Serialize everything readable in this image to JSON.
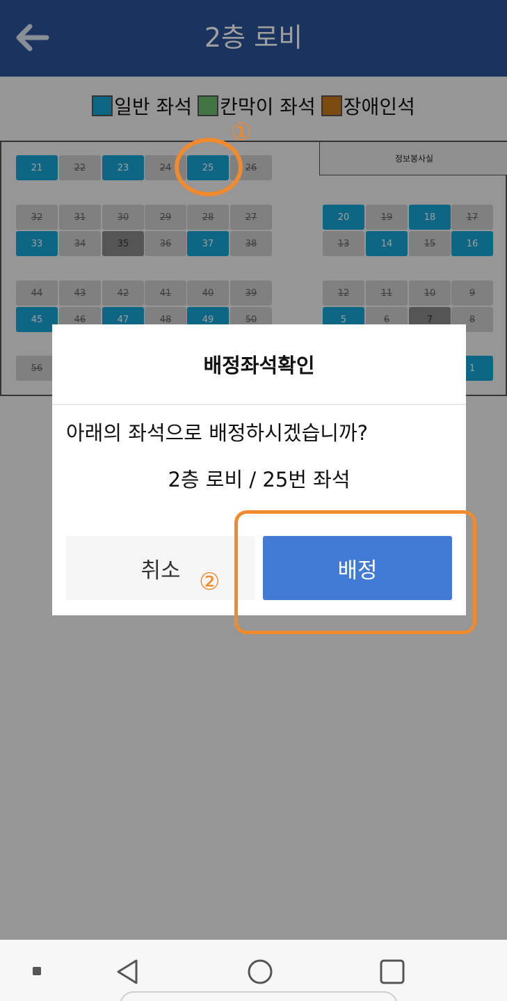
{
  "app_bar": {
    "title": "2층 로비",
    "back_icon": "arrow-left-icon"
  },
  "legend": [
    {
      "label": "일반 좌석",
      "color": "#15a7d6"
    },
    {
      "label": "칸막이 좌석",
      "color": "#6dbb6e"
    },
    {
      "label": "장애인석",
      "color": "#c77a1c"
    }
  ],
  "seat_map": {
    "info_room": "정보봉사실",
    "seats": [
      {
        "label": "21",
        "state": "available"
      },
      {
        "label": "22",
        "state": "taken"
      },
      {
        "label": "23",
        "state": "available"
      },
      {
        "label": "24",
        "state": "taken"
      },
      {
        "label": "25",
        "state": "available"
      },
      {
        "label": "26",
        "state": "taken"
      },
      {
        "label": "32",
        "state": "taken"
      },
      {
        "label": "31",
        "state": "taken"
      },
      {
        "label": "30",
        "state": "taken"
      },
      {
        "label": "29",
        "state": "taken"
      },
      {
        "label": "28",
        "state": "taken"
      },
      {
        "label": "27",
        "state": "taken"
      },
      {
        "label": "33",
        "state": "available"
      },
      {
        "label": "34",
        "state": "taken"
      },
      {
        "label": "35",
        "state": "dark"
      },
      {
        "label": "36",
        "state": "taken"
      },
      {
        "label": "37",
        "state": "available"
      },
      {
        "label": "38",
        "state": "taken"
      },
      {
        "label": "44",
        "state": "taken"
      },
      {
        "label": "43",
        "state": "taken"
      },
      {
        "label": "42",
        "state": "taken"
      },
      {
        "label": "41",
        "state": "taken"
      },
      {
        "label": "40",
        "state": "taken"
      },
      {
        "label": "39",
        "state": "taken"
      },
      {
        "label": "45",
        "state": "available"
      },
      {
        "label": "46",
        "state": "taken"
      },
      {
        "label": "47",
        "state": "available"
      },
      {
        "label": "48",
        "state": "taken"
      },
      {
        "label": "49",
        "state": "available"
      },
      {
        "label": "50",
        "state": "taken"
      },
      {
        "label": "56",
        "state": "taken"
      },
      {
        "label": "20",
        "state": "available"
      },
      {
        "label": "19",
        "state": "taken"
      },
      {
        "label": "18",
        "state": "available"
      },
      {
        "label": "17",
        "state": "taken"
      },
      {
        "label": "13",
        "state": "taken"
      },
      {
        "label": "14",
        "state": "available"
      },
      {
        "label": "15",
        "state": "taken"
      },
      {
        "label": "16",
        "state": "available"
      },
      {
        "label": "12",
        "state": "taken"
      },
      {
        "label": "11",
        "state": "taken"
      },
      {
        "label": "10",
        "state": "taken"
      },
      {
        "label": "9",
        "state": "taken"
      },
      {
        "label": "5",
        "state": "available"
      },
      {
        "label": "6",
        "state": "taken"
      },
      {
        "label": "7",
        "state": "dark"
      },
      {
        "label": "8",
        "state": "taken"
      },
      {
        "label": "1",
        "state": "available"
      }
    ]
  },
  "dialog": {
    "title": "배정좌석확인",
    "message": "아래의 좌석으로 배정하시겠습니까?",
    "detail": "2층 로비 / 25번 좌석",
    "cancel_label": "취소",
    "confirm_label": "배정"
  },
  "annotations": {
    "step1": "①",
    "step2": "②",
    "color": "#f08a2e"
  },
  "nav_bar": {
    "icons": [
      "menu-dot-icon",
      "back-triangle-icon",
      "home-circle-icon",
      "recents-square-icon"
    ]
  }
}
